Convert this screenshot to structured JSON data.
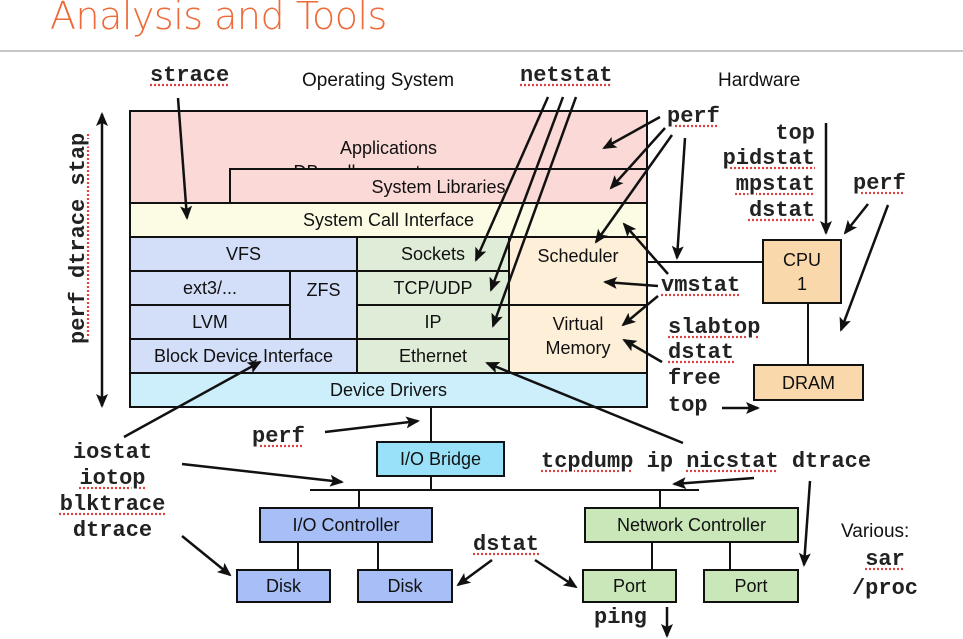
{
  "title": "Analysis and Tools",
  "headings": {
    "os": "Operating System",
    "hardware": "Hardware"
  },
  "os_stack": {
    "applications": [
      "Applications",
      "DBs, all server types, ..."
    ],
    "system_libraries": "System Libraries",
    "system_call_interface": "System Call Interface",
    "vfs": "VFS",
    "ext3": "ext3/...",
    "zfs": "ZFS",
    "lvm": "LVM",
    "block_device_interface": "Block Device Interface",
    "sockets": "Sockets",
    "tcp_udp": "TCP/UDP",
    "ip": "IP",
    "ethernet": "Ethernet",
    "scheduler": "Scheduler",
    "virtual_memory": [
      "Virtual",
      "Memory"
    ],
    "device_drivers": "Device Drivers"
  },
  "hardware": {
    "cpu": [
      "CPU",
      "1"
    ],
    "dram": "DRAM",
    "io_bridge": "I/O Bridge",
    "io_controller": "I/O Controller",
    "disk1": "Disk",
    "disk2": "Disk",
    "network_controller": "Network Controller",
    "port1": "Port",
    "port2": "Port"
  },
  "tools": {
    "strace": "strace",
    "netstat": "netstat",
    "perf_apps": "perf",
    "vertical_stack": "perf dtrace stap",
    "cpu_tools": [
      "top",
      "pidstat",
      "mpstat",
      "dstat"
    ],
    "perf_cpu": "perf",
    "vmstat": "vmstat",
    "mem_tools": [
      "slabtop",
      "dstat",
      "free",
      "top"
    ],
    "perf_bus": "perf",
    "io_tools": [
      "iostat",
      "iotop",
      "blktrace",
      "dtrace"
    ],
    "net_tools": [
      "tcpdump",
      "ip",
      "nicstat",
      "dtrace"
    ],
    "dstat_bottom": "dstat",
    "ping": "ping",
    "various_label": "Various:",
    "various_tools": [
      "sar",
      "/proc"
    ]
  },
  "colors": {
    "title": "#ee6a38",
    "applications": "#fad9d7",
    "syscall": "#fcfbe3",
    "fs": "#d3def9",
    "net": "#dfedd8",
    "sched_vm": "#fdefd8",
    "drivers": "#cdeffc",
    "cpu_dram": "#f9d8ab",
    "io_bridge": "#99e1f9",
    "io_ctrl": "#a7bff6",
    "net_ctrl": "#c9e7b8"
  }
}
